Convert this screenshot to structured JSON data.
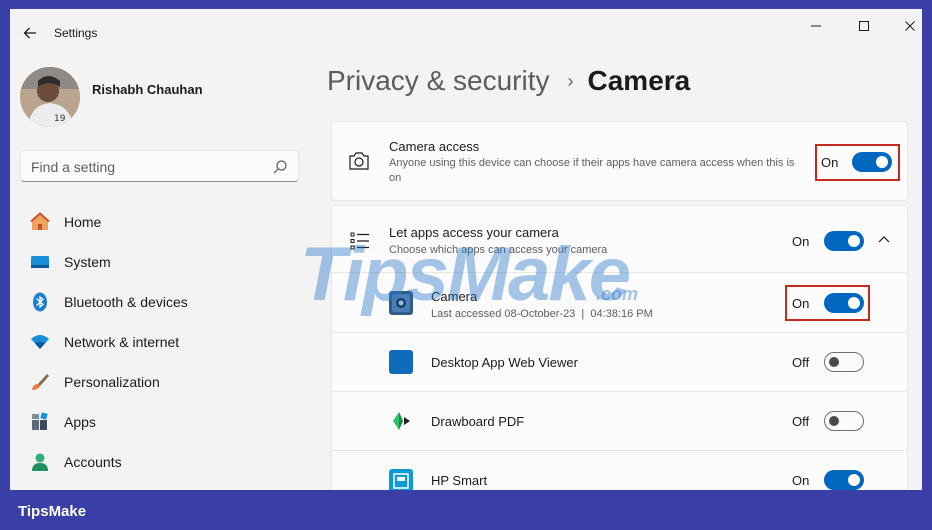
{
  "window": {
    "title": "Settings",
    "controls": {
      "minimize": "minimize-icon",
      "maximize": "maximize-icon",
      "close": "close-icon"
    }
  },
  "user": {
    "name": "Rishabh Chauhan"
  },
  "search": {
    "placeholder": "Find a setting"
  },
  "sidebar": {
    "items": [
      {
        "label": "Home",
        "icon": "home-icon"
      },
      {
        "label": "System",
        "icon": "system-icon"
      },
      {
        "label": "Bluetooth & devices",
        "icon": "bluetooth-icon"
      },
      {
        "label": "Network & internet",
        "icon": "wifi-icon"
      },
      {
        "label": "Personalization",
        "icon": "brush-icon"
      },
      {
        "label": "Apps",
        "icon": "apps-icon"
      },
      {
        "label": "Accounts",
        "icon": "person-icon"
      }
    ]
  },
  "breadcrumb": {
    "parent": "Privacy & security",
    "separator": "›",
    "current": "Camera"
  },
  "camera_access": {
    "title": "Camera access",
    "description": "Anyone using this device can choose if their apps have camera access when this is on",
    "state": "On"
  },
  "let_apps": {
    "title": "Let apps access your camera",
    "description": "Choose which apps can access your camera",
    "state": "On"
  },
  "apps": [
    {
      "name": "Camera",
      "detail": "Last accessed 08-October-23  |  04:38:16 PM",
      "state": "On",
      "icon": "camera-app-icon"
    },
    {
      "name": "Desktop App Web Viewer",
      "state": "Off",
      "icon": "web-viewer-icon"
    },
    {
      "name": "Drawboard PDF",
      "state": "Off",
      "icon": "drawboard-icon"
    },
    {
      "name": "HP Smart",
      "state": "On",
      "icon": "hp-smart-icon"
    }
  ],
  "watermark": {
    "text": "TipsMake",
    "suffix": ".com"
  },
  "footer": {
    "brand": "TipsMake"
  },
  "colors": {
    "accent": "#0067c0",
    "highlight": "#c42b1c",
    "frame": "#3a3fa6"
  }
}
